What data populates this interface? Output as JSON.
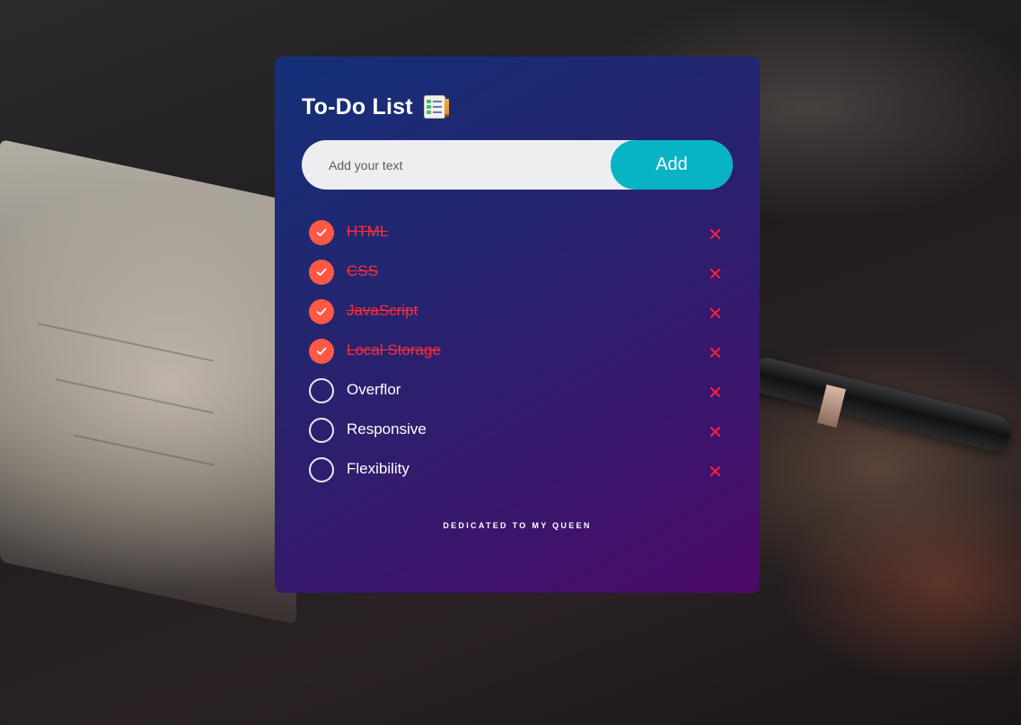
{
  "app": {
    "title": "To-Do List",
    "title_icon": "notepad-checklist-icon"
  },
  "input": {
    "placeholder": "Add your text",
    "value": "",
    "add_label": "Add"
  },
  "tasks": [
    {
      "label": "HTML",
      "done": true
    },
    {
      "label": "CSS",
      "done": true
    },
    {
      "label": "JavaScript",
      "done": true
    },
    {
      "label": "Local Storage",
      "done": true
    },
    {
      "label": "Overflor",
      "done": false
    },
    {
      "label": "Responsive",
      "done": false
    },
    {
      "label": "Flexibility",
      "done": false
    }
  ],
  "footer": {
    "text": "DEDICATED TO MY QUEEN"
  },
  "colors": {
    "accent": "#08b3c4",
    "done_check": "#ff5945",
    "done_text": "#ff2b3a",
    "delete": "#ff1f3d"
  }
}
